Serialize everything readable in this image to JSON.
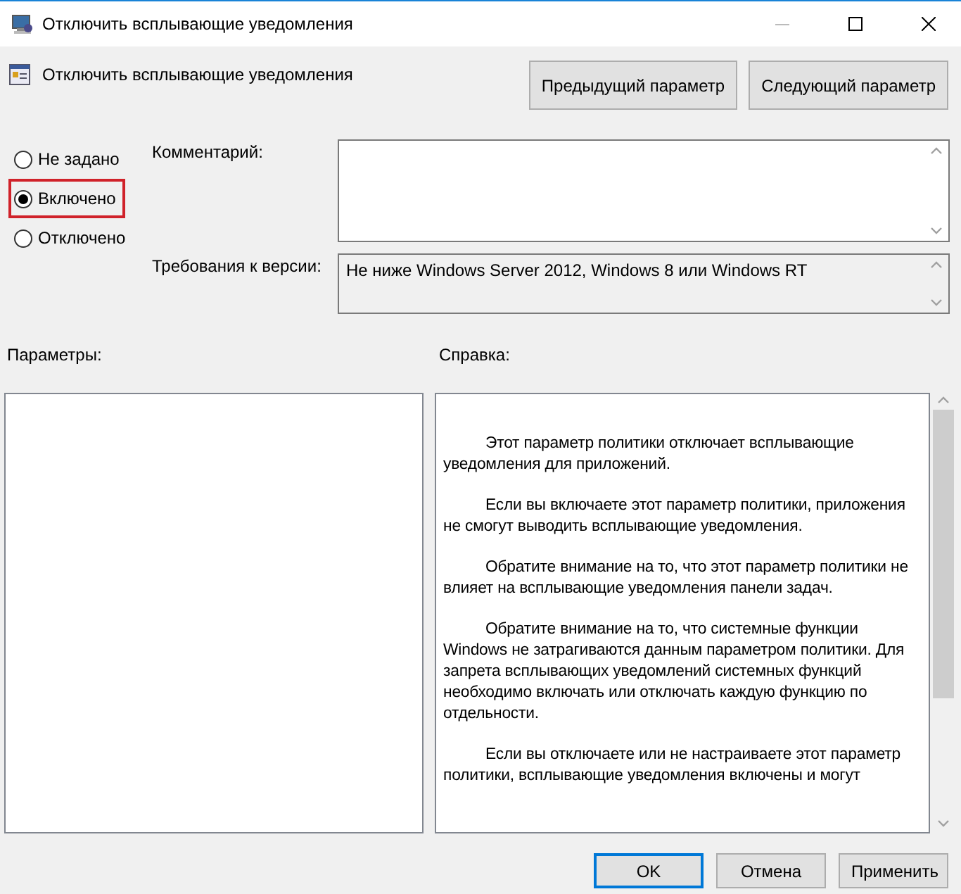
{
  "window": {
    "title": "Отключить всплывающие уведомления"
  },
  "policy": {
    "name": "Отключить всплывающие уведомления"
  },
  "nav_buttons": [
    "Предыдущий параметр",
    "Следующий параметр"
  ],
  "state_options": [
    {
      "label": "Не задано",
      "selected": false
    },
    {
      "label": "Включено",
      "selected": true
    },
    {
      "label": "Отключено",
      "selected": false
    }
  ],
  "comment": {
    "label": "Комментарий:"
  },
  "version_requirements": {
    "label": "Требования к версии:",
    "value": "Не ниже Windows Server 2012, Windows 8 или Windows RT"
  },
  "options_panel": {
    "label": "Параметры:"
  },
  "help_panel": {
    "label": "Справка:",
    "paragraphs": [
      "Этот параметр политики отключает всплывающие уведомления для приложений.",
      "Если вы включаете этот параметр политики, приложения не смогут выводить всплывающие уведомления.",
      "Обратите внимание на то, что этот параметр политики не влияет на всплывающие уведомления панели задач.",
      "Обратите внимание на то, что системные функции Windows не затрагиваются данным параметром политики. Для запрета всплывающих уведомлений системных функций необходимо включать или отключать каждую функцию по отдельности.",
      "Если вы отключаете или не настраиваете этот параметр политики, всплывающие уведомления включены и могут"
    ]
  },
  "buttons": [
    {
      "label": "OK",
      "default": true
    },
    {
      "label": "Отмена",
      "default": false
    },
    {
      "label": "Применить",
      "default": false
    }
  ]
}
